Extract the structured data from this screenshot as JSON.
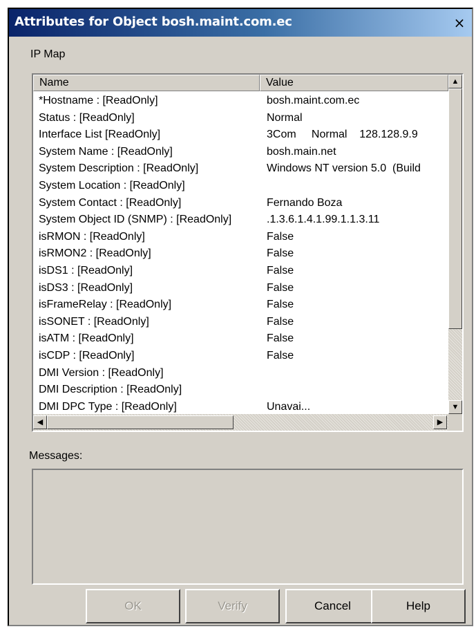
{
  "window": {
    "title": "Attributes for Object bosh.maint.com.ec",
    "close_glyph": "×"
  },
  "section_label": "IP Map",
  "table": {
    "columns": [
      "Name",
      "Value"
    ],
    "rows": [
      {
        "name": "*Hostname : [ReadOnly]",
        "value": "bosh.maint.com.ec"
      },
      {
        "name": "Status : [ReadOnly]",
        "value": "Normal"
      },
      {
        "name": "Interface List [ReadOnly]",
        "value": "3Com     Normal    128.128.9.9"
      },
      {
        "name": "System Name : [ReadOnly]",
        "value": "bosh.main.net"
      },
      {
        "name": "System Description : [ReadOnly]",
        "value": "Windows NT version 5.0  (Build"
      },
      {
        "name": "System Location : [ReadOnly]",
        "value": ""
      },
      {
        "name": "System Contact : [ReadOnly]",
        "value": "Fernando Boza"
      },
      {
        "name": "System Object ID (SNMP) : [ReadOnly]",
        "value": ".1.3.6.1.4.1.99.1.1.3.11"
      },
      {
        "name": "isRMON : [ReadOnly]",
        "value": "False"
      },
      {
        "name": "isRMON2 : [ReadOnly]",
        "value": "False"
      },
      {
        "name": "isDS1 : [ReadOnly]",
        "value": "False"
      },
      {
        "name": "isDS3 : [ReadOnly]",
        "value": "False"
      },
      {
        "name": "isFrameRelay : [ReadOnly]",
        "value": "False"
      },
      {
        "name": "isSONET : [ReadOnly]",
        "value": "False"
      },
      {
        "name": "isATM : [ReadOnly]",
        "value": "False"
      },
      {
        "name": "isCDP : [ReadOnly]",
        "value": "False"
      },
      {
        "name": "DMI Version : [ReadOnly]",
        "value": ""
      },
      {
        "name": "DMI Description : [ReadOnly]",
        "value": ""
      },
      {
        "name": "DMI DPC Type : [ReadOnly]",
        "value": "Unavai..."
      }
    ]
  },
  "scrollbars": {
    "up_glyph": "▲",
    "down_glyph": "▼",
    "left_glyph": "◀",
    "right_glyph": "▶"
  },
  "messages_label": "Messages:",
  "buttons": {
    "ok": "OK",
    "verify": "Verify",
    "cancel": "Cancel",
    "help": "Help"
  },
  "icons": {
    "close": "close-icon",
    "scroll_up": "arrow-up-icon",
    "scroll_down": "arrow-down-icon",
    "scroll_left": "arrow-left-icon",
    "scroll_right": "arrow-right-icon"
  },
  "colors": {
    "title_gradient_start": "#0a246a",
    "title_gradient_end": "#a6caf0",
    "dialog_face": "#d4d0c8"
  }
}
